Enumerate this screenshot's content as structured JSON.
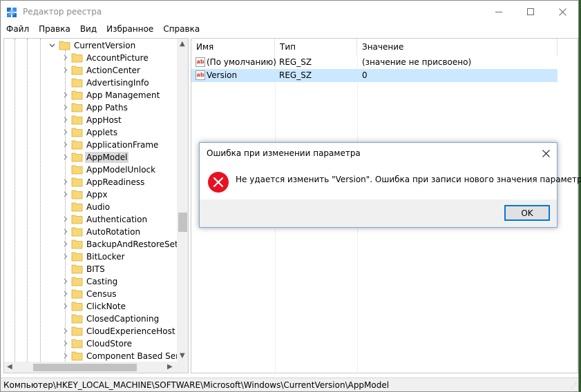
{
  "window": {
    "title": "Редактор реестра",
    "icon": "regedit-icon"
  },
  "menu": [
    "Файл",
    "Правка",
    "Вид",
    "Избранное",
    "Справка"
  ],
  "tree": {
    "parent": "CurrentVersion",
    "selected": "AppModel",
    "items": [
      {
        "label": "AccountPicture",
        "expandable": true
      },
      {
        "label": "ActionCenter",
        "expandable": true
      },
      {
        "label": "AdvertisingInfo",
        "expandable": false
      },
      {
        "label": "App Management",
        "expandable": true
      },
      {
        "label": "App Paths",
        "expandable": true
      },
      {
        "label": "AppHost",
        "expandable": true
      },
      {
        "label": "Applets",
        "expandable": true
      },
      {
        "label": "ApplicationFrame",
        "expandable": true
      },
      {
        "label": "AppModel",
        "expandable": true
      },
      {
        "label": "AppModelUnlock",
        "expandable": false
      },
      {
        "label": "AppReadiness",
        "expandable": true
      },
      {
        "label": "Appx",
        "expandable": true
      },
      {
        "label": "Audio",
        "expandable": false
      },
      {
        "label": "Authentication",
        "expandable": true
      },
      {
        "label": "AutoRotation",
        "expandable": true
      },
      {
        "label": "BackupAndRestoreSettir",
        "expandable": true
      },
      {
        "label": "BitLocker",
        "expandable": true
      },
      {
        "label": "BITS",
        "expandable": false
      },
      {
        "label": "Casting",
        "expandable": true
      },
      {
        "label": "Census",
        "expandable": true
      },
      {
        "label": "ClickNote",
        "expandable": true
      },
      {
        "label": "ClosedCaptioning",
        "expandable": false
      },
      {
        "label": "CloudExperienceHost",
        "expandable": true
      },
      {
        "label": "CloudStore",
        "expandable": true
      },
      {
        "label": "Component Based Servi",
        "expandable": true
      }
    ]
  },
  "list": {
    "columns": [
      "Имя",
      "Тип",
      "Значение"
    ],
    "rows": [
      {
        "name": "(По умолчанию)",
        "type": "REG_SZ",
        "value": "(значение не присвоено)",
        "icon": "string-value-icon"
      },
      {
        "name": "Version",
        "type": "REG_SZ",
        "value": "0",
        "icon": "string-value-icon"
      }
    ],
    "selected_row": 1
  },
  "status": {
    "path": "Компьютер\\HKEY_LOCAL_MACHINE\\SOFTWARE\\Microsoft\\Windows\\CurrentVersion\\AppModel"
  },
  "dialog": {
    "title": "Ошибка при изменении параметра",
    "message": "Не удается изменить \"Version\".  Ошибка при записи нового значения параметра.",
    "ok_label": "OK",
    "icon": "error-icon"
  },
  "colors": {
    "accent": "#0078d7",
    "selected_row": "#cce8ff",
    "error_red": "#e81123",
    "folder_yellow": "#f8d775"
  }
}
